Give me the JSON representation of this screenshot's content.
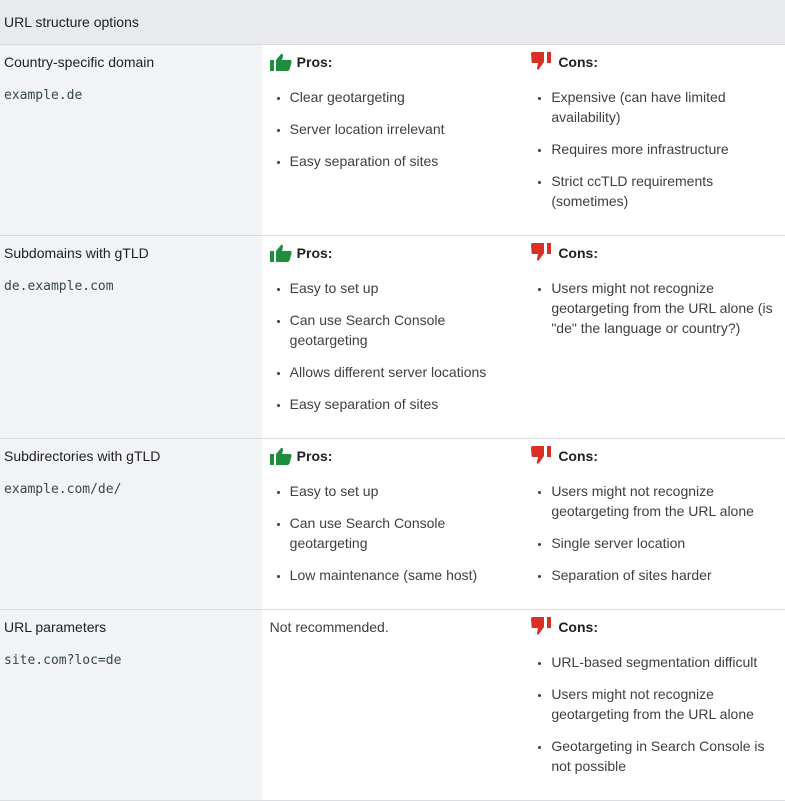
{
  "header": {
    "title": "URL structure options"
  },
  "labels": {
    "pros": "Pros:",
    "cons": "Cons:"
  },
  "colors": {
    "pros_icon": "#1e8e3e",
    "cons_icon": "#d93025"
  },
  "rows": [
    {
      "name": "Country-specific domain",
      "example": "example.de",
      "pros": [
        "Clear geotargeting",
        "Server location irrelevant",
        "Easy separation of sites"
      ],
      "cons": [
        "Expensive (can have limited availability)",
        "Requires more infrastructure",
        "Strict ccTLD requirements (sometimes)"
      ]
    },
    {
      "name": "Subdomains with gTLD",
      "example": "de.example.com",
      "pros": [
        "Easy to set up",
        "Can use Search Console geotargeting",
        "Allows different server locations",
        "Easy separation of sites"
      ],
      "cons": [
        "Users might not recognize geotargeting from the URL alone (is \"de\" the language or country?)"
      ]
    },
    {
      "name": "Subdirectories with gTLD",
      "example": "example.com/de/",
      "pros": [
        "Easy to set up",
        "Can use Search Console geotargeting",
        "Low maintenance (same host)"
      ],
      "cons": [
        "Users might not recognize geotargeting from the URL alone",
        "Single server location",
        "Separation of sites harder"
      ]
    },
    {
      "name": "URL parameters",
      "example": "site.com?loc=de",
      "pros_text": "Not recommended.",
      "cons": [
        "URL-based segmentation difficult",
        "Users might not recognize geotargeting from the URL alone",
        "Geotargeting in Search Console is not possible"
      ]
    }
  ]
}
